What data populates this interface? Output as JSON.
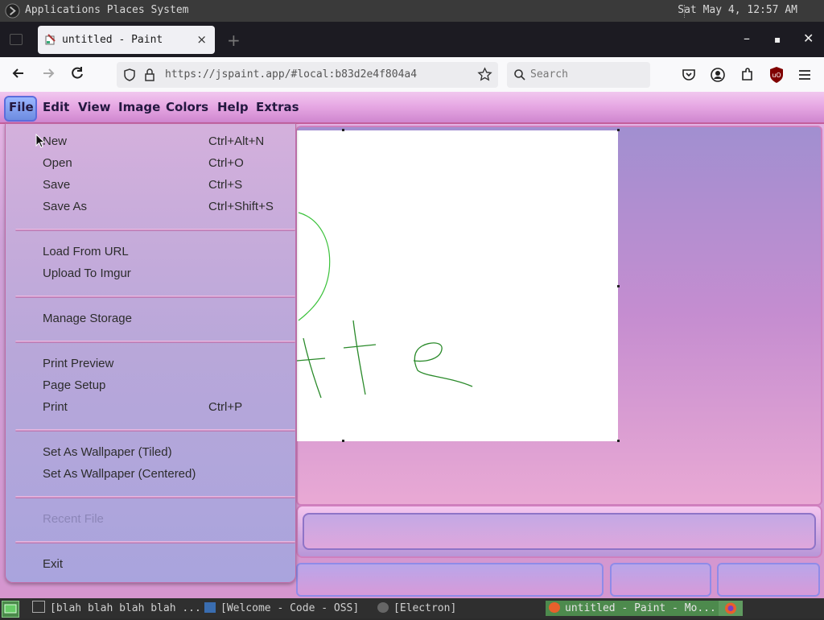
{
  "system_panel": {
    "menus": "Applications Places System",
    "clock": "Sat May  4, 12:57 AM"
  },
  "browser": {
    "tab_title": "untitled - Paint",
    "close_tab_glyph": "×",
    "new_tab_glyph": "+",
    "url": "https://jspaint.app/#local:b83d2e4f804a4",
    "search_placeholder": "Search",
    "window_controls": {
      "minimize": "–",
      "maximize": "▪",
      "close": "✕"
    }
  },
  "app_menu": [
    "File",
    "Edit",
    "View",
    "Image",
    "Colors",
    "Help",
    "Extras"
  ],
  "file_menu": {
    "group1": [
      {
        "label": "New",
        "shortcut": "Ctrl+Alt+N"
      },
      {
        "label": "Open",
        "shortcut": "Ctrl+O"
      },
      {
        "label": "Save",
        "shortcut": "Ctrl+S"
      },
      {
        "label": "Save As",
        "shortcut": "Ctrl+Shift+S"
      }
    ],
    "group2": [
      {
        "label": "Load From URL"
      },
      {
        "label": "Upload To Imgur"
      }
    ],
    "group3": [
      {
        "label": "Manage Storage"
      }
    ],
    "group4": [
      {
        "label": "Print Preview"
      },
      {
        "label": "Page Setup"
      },
      {
        "label": "Print",
        "shortcut": "Ctrl+P"
      }
    ],
    "group5": [
      {
        "label": "Set As Wallpaper (Tiled)"
      },
      {
        "label": "Set As Wallpaper (Centered)"
      }
    ],
    "group6": [
      {
        "label": "Recent File",
        "disabled": true
      }
    ],
    "group7": [
      {
        "label": "Exit"
      }
    ]
  },
  "taskbar": {
    "items": [
      "[blah blah blah blah ...",
      "[Welcome - Code - OSS]",
      "[Electron]",
      "untitled - Paint - Mo..."
    ]
  },
  "colors": {
    "stroke_green": "#2a8a2a",
    "stroke_light_green": "#3cc23c",
    "menu_text": "#241840"
  }
}
